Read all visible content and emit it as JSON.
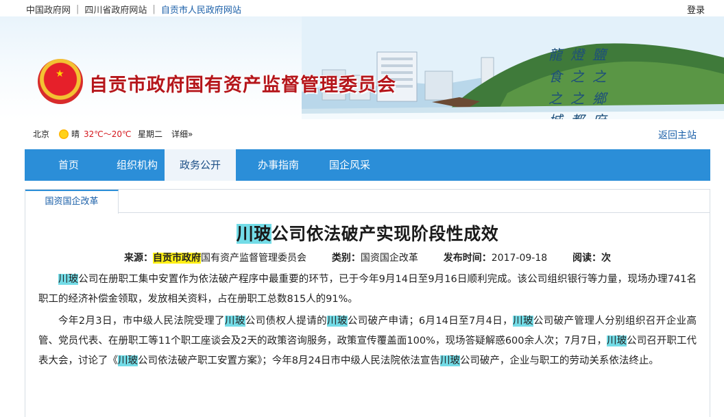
{
  "topbar": {
    "links": [
      "中国政府网",
      "四川省政府网站",
      "自贡市人民政府网站"
    ],
    "login": "登录"
  },
  "banner": {
    "title": "自贡市政府国有资产监督管理委员会",
    "calligraphy": "龍燈鹽食之之之之鄉城都府",
    "emblem": "national-emblem"
  },
  "inforow": {
    "city": "北京",
    "weather": "晴",
    "temp": "32℃～20℃",
    "weekday": "星期二",
    "detail": "详细»",
    "return": "返回主站"
  },
  "nav": {
    "items": [
      "首页",
      "组织机构",
      "政务公开",
      "办事指南",
      "国企风采"
    ],
    "active_index": 2
  },
  "panel": {
    "tab": "国资国企改革"
  },
  "article": {
    "title_hl": "川玻",
    "title_rest": "公司依法破产实现阶段性成效",
    "meta": {
      "source_label": "来源：",
      "source_hl": "自贡市政府",
      "source_rest": "国有资产监督管理委员会",
      "category_label": "类别：",
      "category": "国资国企改革",
      "date_label": "发布时间：",
      "date": "2017-09-18",
      "reads_label": "阅读：",
      "reads": "次"
    },
    "paragraphs": [
      [
        {
          "t": "川玻",
          "hl": "cyan"
        },
        {
          "t": "公司在册职工集中安置作为依法破产程序中最重要的环节，已于今年9月14日至9月16日顺利完成。该公司组织银行等力量，现场办理741名职工的经济补偿金领取，发放相关资料，占在册职工总数815人的91%。"
        }
      ],
      [
        {
          "t": "今年2月3日，市中级人民法院受理了"
        },
        {
          "t": "川玻",
          "hl": "cyan"
        },
        {
          "t": "公司债权人提请的"
        },
        {
          "t": "川玻",
          "hl": "cyan"
        },
        {
          "t": "公司破产申请；6月14日至7月4日，"
        },
        {
          "t": "川玻",
          "hl": "cyan"
        },
        {
          "t": "公司破产管理人分别组织召开企业高管、党员代表、在册职工等11个职工座谈会及2天的政策咨询服务，政策宣传覆盖面100%，现场答疑解惑600余人次；7月7日，"
        },
        {
          "t": "川玻",
          "hl": "cyan"
        },
        {
          "t": "公司召开职工代表大会，讨论了《"
        },
        {
          "t": "川玻",
          "hl": "cyan"
        },
        {
          "t": "公司依法破产职工安置方案》；今年8月24日市中级人民法院依法宣告"
        },
        {
          "t": "川玻",
          "hl": "cyan"
        },
        {
          "t": "公司破产，企业与职工的劳动关系依法终止。"
        }
      ]
    ]
  },
  "colors": {
    "nav_bg": "#2b8ed8",
    "title_red": "#b5161b",
    "highlight_cyan": "#73dce7",
    "highlight_yellow": "#fff016",
    "link_blue": "#1a5fa8"
  }
}
